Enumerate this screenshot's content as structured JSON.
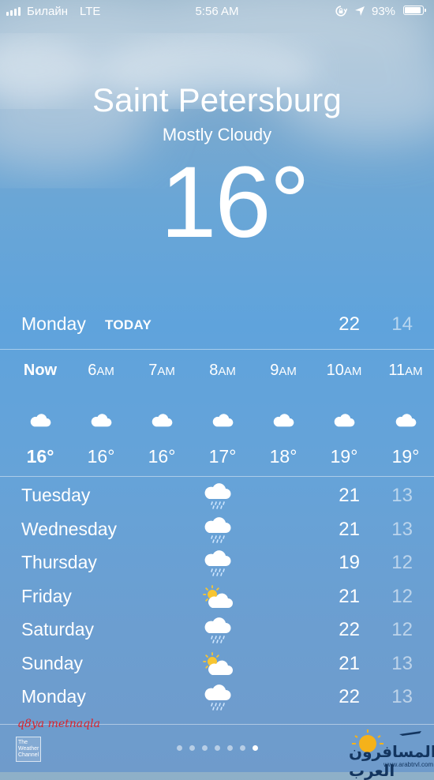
{
  "status_bar": {
    "carrier": "Билайн",
    "network": "LTE",
    "time": "5:56 AM",
    "battery_percent": "93%",
    "battery_level": 0.93
  },
  "location": {
    "city": "Saint Petersburg",
    "condition": "Mostly Cloudy",
    "temperature": "16°"
  },
  "today": {
    "day": "Monday",
    "tag": "TODAY",
    "high": "22",
    "low": "14"
  },
  "hourly": [
    {
      "hour": "Now",
      "suffix": "",
      "icon": "cloud-icon",
      "temp": "16°"
    },
    {
      "hour": "6",
      "suffix": "AM",
      "icon": "cloud-icon",
      "temp": "16°"
    },
    {
      "hour": "7",
      "suffix": "AM",
      "icon": "cloud-icon",
      "temp": "16°"
    },
    {
      "hour": "8",
      "suffix": "AM",
      "icon": "cloud-icon",
      "temp": "17°"
    },
    {
      "hour": "9",
      "suffix": "AM",
      "icon": "cloud-icon",
      "temp": "18°"
    },
    {
      "hour": "10",
      "suffix": "AM",
      "icon": "cloud-icon",
      "temp": "19°"
    },
    {
      "hour": "11",
      "suffix": "AM",
      "icon": "cloud-icon",
      "temp": "19°"
    }
  ],
  "daily": [
    {
      "day": "Tuesday",
      "icon": "rain-cloud-icon",
      "high": "21",
      "low": "13"
    },
    {
      "day": "Wednesday",
      "icon": "rain-cloud-icon",
      "high": "21",
      "low": "13"
    },
    {
      "day": "Thursday",
      "icon": "rain-cloud-icon",
      "high": "19",
      "low": "12"
    },
    {
      "day": "Friday",
      "icon": "partly-cloudy-icon",
      "high": "21",
      "low": "12"
    },
    {
      "day": "Saturday",
      "icon": "rain-cloud-icon",
      "high": "22",
      "low": "12"
    },
    {
      "day": "Sunday",
      "icon": "partly-cloudy-icon",
      "high": "21",
      "low": "13"
    },
    {
      "day": "Monday",
      "icon": "rain-cloud-icon",
      "high": "22",
      "low": "13"
    }
  ],
  "footer": {
    "weather_channel_label": "The Weather Channel",
    "page_count": 7,
    "active_page": 7,
    "watermark": "q8ya metnaqla",
    "site_logo_text": "المسافرون العرب",
    "site_url": "www.arabtrvl.com"
  },
  "colors": {
    "sky_top": "#8fb0c8",
    "sky_mid": "#5fa3dc",
    "sun": "#f7c531",
    "rain": "#cfe6ff"
  }
}
